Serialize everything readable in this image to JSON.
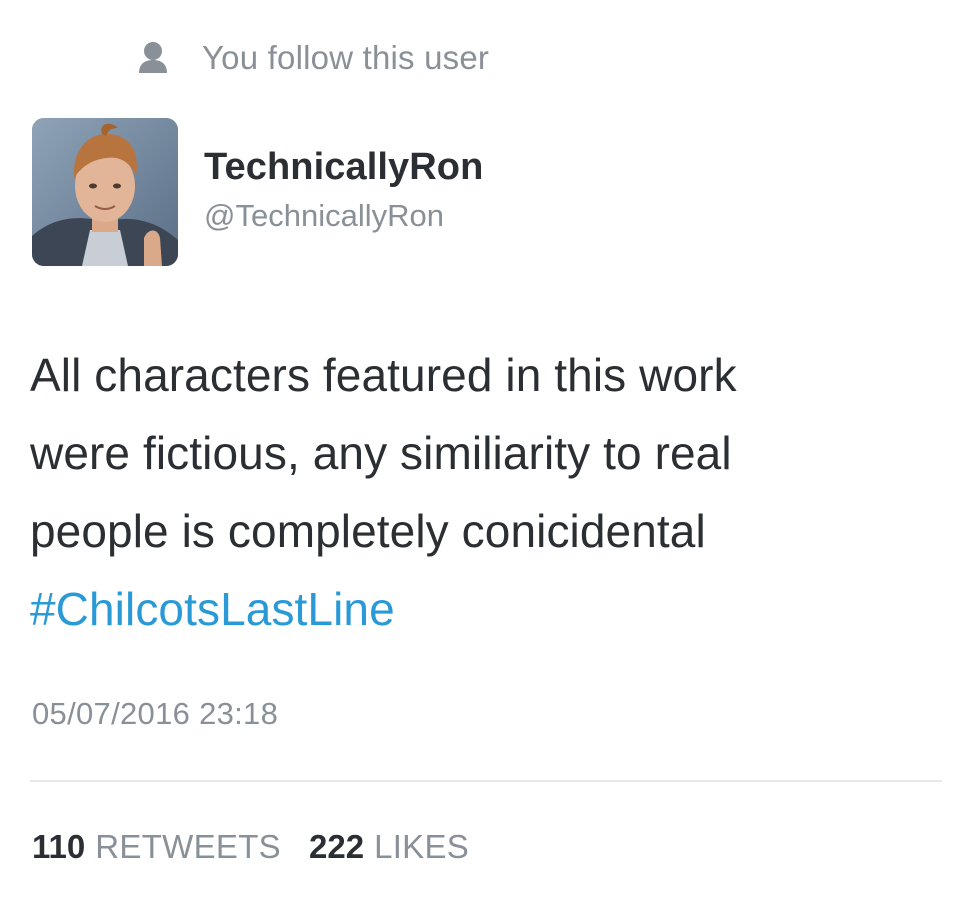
{
  "follow_status": {
    "text": "You follow this user",
    "icon": "person-icon"
  },
  "author": {
    "display_name": "TechnicallyRon",
    "handle": "@TechnicallyRon",
    "avatar": "avatar"
  },
  "tweet": {
    "lines": [
      "All characters featured in this work",
      "were fictious, any similiarity to real",
      "people is completely conicidental"
    ],
    "hashtag": "#ChilcotsLastLine",
    "timestamp": "05/07/2016 23:18"
  },
  "stats": {
    "retweets_count": "110",
    "retweets_label": "RETWEETS",
    "likes_count": "222",
    "likes_label": "LIKES"
  },
  "colors": {
    "hashtag": "#2a9ad6",
    "muted_text": "#8a9097",
    "primary_text": "#2b2f33"
  }
}
